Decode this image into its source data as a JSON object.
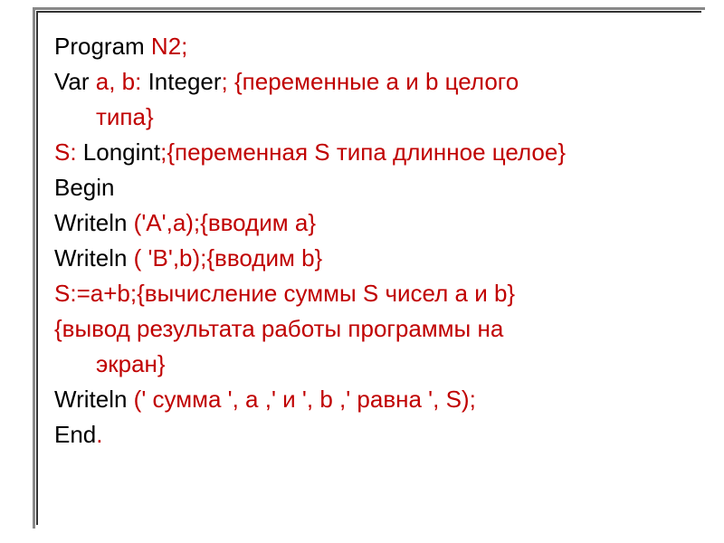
{
  "lines": [
    {
      "parts": [
        {
          "text": "Program",
          "color": "black"
        },
        {
          "text": " N2;",
          "color": "red"
        }
      ],
      "indent": false
    },
    {
      "parts": [
        {
          "text": "Var",
          "color": "black"
        },
        {
          "text": " a, b: ",
          "color": "red"
        },
        {
          "text": "Integer",
          "color": "black"
        },
        {
          "text": "; {переменные a и b целого",
          "color": "red"
        }
      ],
      "indent": false
    },
    {
      "parts": [
        {
          "text": "типа}",
          "color": "red"
        }
      ],
      "indent": true
    },
    {
      "parts": [
        {
          "text": "S: ",
          "color": "red"
        },
        {
          "text": "Longint",
          "color": "black"
        },
        {
          "text": ";{переменная S типа длинное целое}",
          "color": "red"
        }
      ],
      "indent": false
    },
    {
      "parts": [
        {
          "text": "Begin",
          "color": "black"
        }
      ],
      "indent": false
    },
    {
      "parts": [
        {
          "text": "Writeln",
          "color": "black"
        },
        {
          "text": " ('A',a);{вводим  a}",
          "color": "red"
        }
      ],
      "indent": false
    },
    {
      "parts": [
        {
          "text": "Writeln",
          "color": "black"
        },
        {
          "text": " ( 'B',b);{вводим b}",
          "color": "red"
        }
      ],
      "indent": false
    },
    {
      "parts": [
        {
          "text": "S:=a+b;{вычисление суммы S чисел a и b}",
          "color": "red"
        }
      ],
      "indent": false
    },
    {
      "parts": [
        {
          "text": "{вывод результата работы программы на",
          "color": "red"
        }
      ],
      "indent": false
    },
    {
      "parts": [
        {
          "text": "экран}",
          "color": "red"
        }
      ],
      "indent": true
    },
    {
      "parts": [
        {
          "text": "Writeln",
          "color": "black"
        },
        {
          "text": " (' сумма ', a ,' и ', b ,' равна ', S);",
          "color": "red"
        }
      ],
      "indent": false
    },
    {
      "parts": [
        {
          "text": "End",
          "color": "black"
        },
        {
          "text": ".",
          "color": "red"
        }
      ],
      "indent": false
    }
  ]
}
